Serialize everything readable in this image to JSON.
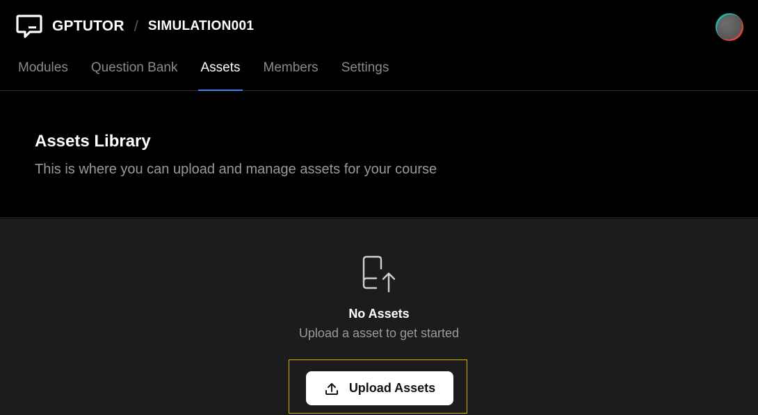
{
  "header": {
    "brand": "GPTUTOR",
    "separator": "/",
    "course": "SIMULATION001",
    "logo_icon": "message-square-icon",
    "avatar_icon": "user-avatar"
  },
  "tabs": [
    {
      "label": "Modules",
      "active": false
    },
    {
      "label": "Question Bank",
      "active": false
    },
    {
      "label": "Assets",
      "active": true
    },
    {
      "label": "Members",
      "active": false
    },
    {
      "label": "Settings",
      "active": false
    }
  ],
  "hero": {
    "title": "Assets Library",
    "subtitle": "This is where you can upload and manage assets for your course"
  },
  "empty_state": {
    "icon": "file-upload-icon",
    "title": "No Assets",
    "subtitle": "Upload a asset to get started",
    "button_label": "Upload Assets",
    "button_icon": "upload-icon"
  },
  "colors": {
    "background": "#000000",
    "content_background": "#1c1c1c",
    "tab_active_underline": "#3b82f6",
    "highlight_border": "#d4b400",
    "muted_text": "#9a9a9a"
  }
}
